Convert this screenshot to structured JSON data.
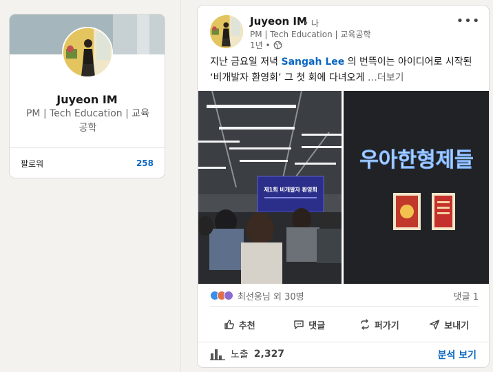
{
  "profile": {
    "name": "Juyeon IM",
    "headline": "PM | Tech Education | 교육공학",
    "followers_label": "팔로워",
    "followers_count": "258"
  },
  "post": {
    "author_name": "Juyeon IM",
    "degree": "• 나",
    "author_headline": "PM | Tech Education | 교육공학",
    "time": "1년 •",
    "text_before": "지난 금요일 저녁 ",
    "mention": "Sangah Lee",
    "text_after": " 의 번뜩이는 아이디어로 시작된 ‘비개발자 환영회’ 그 첫 회에 다녀오게 ",
    "see_more": "…더보기",
    "image_left_slide_title": "제1회 비개발자 환영회",
    "image_right_sign": "우아한형제들",
    "reactors": "최선웅님 외 30명",
    "comments_count": "댓글 1",
    "actions": {
      "like": "추천",
      "comment": "댓글",
      "repost": "퍼가기",
      "send": "보내기"
    },
    "impressions_label": "노출",
    "impressions_value": "2,327",
    "analytics_label": "분석 보기"
  },
  "colors": {
    "brand_blue": "#0a66c2",
    "background": "#f4f2ee"
  }
}
